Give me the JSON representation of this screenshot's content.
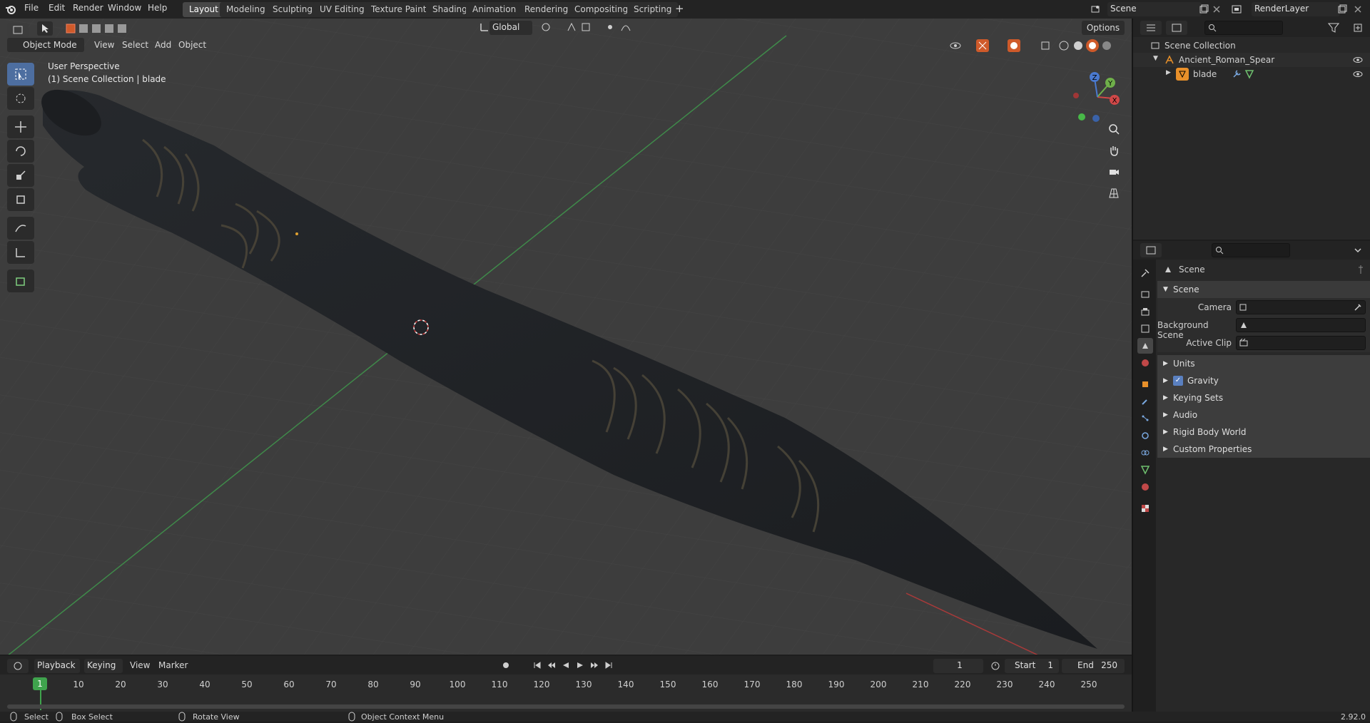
{
  "topbar": {
    "menus": [
      "File",
      "Edit",
      "Render",
      "Window",
      "Help"
    ],
    "workspaces": [
      "Layout",
      "Modeling",
      "Sculpting",
      "UV Editing",
      "Texture Paint",
      "Shading",
      "Animation",
      "Rendering",
      "Compositing",
      "Scripting"
    ],
    "active_workspace": "Layout",
    "add_tab": "+",
    "scene_name": "Scene",
    "view_layer": "RenderLayer"
  },
  "viewport_header": {
    "mode": "Object Mode",
    "menus": [
      "View",
      "Select",
      "Add",
      "Object"
    ],
    "transform_orientation": "Global",
    "options": "Options"
  },
  "viewport": {
    "perspective_label": "User Perspective",
    "collection_label": "(1) Scene Collection | blade",
    "gizmo": {
      "x": "X",
      "y": "Y",
      "z": "Z"
    }
  },
  "timeline": {
    "menus": [
      "Playback",
      "Keying",
      "View",
      "Marker"
    ],
    "current_frame": "1",
    "start_label": "Start",
    "start": "1",
    "end_label": "End",
    "end": "250",
    "marker_frame": "1",
    "frame_ticks": [
      "10",
      "20",
      "30",
      "40",
      "50",
      "60",
      "70",
      "80",
      "90",
      "100",
      "110",
      "120",
      "130",
      "140",
      "150",
      "160",
      "170",
      "180",
      "190",
      "200",
      "210",
      "220",
      "230",
      "240",
      "250"
    ]
  },
  "statusbar": {
    "select": "Select",
    "box_select": "Box Select",
    "rotate_view": "Rotate View",
    "context_menu": "Object Context Menu",
    "version": "2.92.0"
  },
  "outliner": {
    "root": "Scene Collection",
    "items": [
      {
        "name": "Ancient_Roman_Spear",
        "level": 1
      },
      {
        "name": "blade",
        "level": 2
      }
    ]
  },
  "properties": {
    "context_title": "Scene",
    "panel_title": "Scene",
    "fields": [
      {
        "label": "Camera",
        "value": ""
      },
      {
        "label": "Background Scene",
        "value": ""
      },
      {
        "label": "Active Clip",
        "value": ""
      }
    ],
    "sub_panels": [
      "Units",
      "Gravity",
      "Keying Sets",
      "Audio",
      "Rigid Body World",
      "Custom Properties"
    ],
    "gravity_checked": true
  },
  "colors": {
    "accent": "#4d6ea0",
    "viewport_bg": "#3d3d3d",
    "grid_green": "#3f8a4a",
    "axis_red": "#a83a3a",
    "frame_marker": "#3fa34d"
  }
}
